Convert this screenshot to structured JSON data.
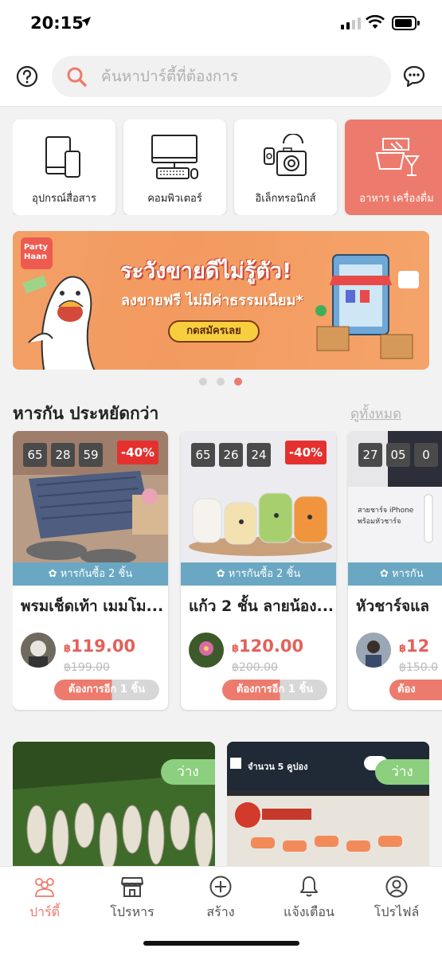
{
  "status": {
    "time": "20:15"
  },
  "search": {
    "placeholder": "ค้นหาปาร์ตี้ที่ต้องการ"
  },
  "categories": [
    {
      "label": "อุปกรณ์สื่อสาร",
      "icon": "phone-tablet-icon"
    },
    {
      "label": "คอมพิวเตอร์",
      "icon": "computer-icon"
    },
    {
      "label": "อิเล็กทรอนิกส์",
      "icon": "electronics-icon"
    },
    {
      "label": "อาหาร เครื่องดื่ม",
      "icon": "food-drink-icon",
      "active": true
    }
  ],
  "banner": {
    "logo": "Party Haan",
    "headline": "ระวังขายดีไม่รู้ตัว!",
    "subline": "ลงขายฟรี ไม่มีค่าธรรมเนียม*",
    "cta": "กดสมัครเลย"
  },
  "section": {
    "title": "หารกัน ประหยัดกว่า",
    "see_all": "ดูทั้งหมด"
  },
  "deals": [
    {
      "timer": [
        "65",
        "28",
        "59"
      ],
      "discount": "-40%",
      "group_tag": "หารกันซื้อ 2 ชิ้น",
      "name": "พรมเช็ดเท้า เมมโม...",
      "currency": "฿",
      "price": "119.00",
      "original_price": "฿199.00",
      "need": "ต้องการอีก 1 ชิ้น"
    },
    {
      "timer": [
        "65",
        "26",
        "24"
      ],
      "discount": "-40%",
      "group_tag": "หารกันซื้อ 2 ชิ้น",
      "name": "แก้ว 2 ชั้น ลายน้อง...",
      "currency": "฿",
      "price": "120.00",
      "original_price": "฿200.00",
      "need": "ต้องการอีก 1 ชิ้น"
    },
    {
      "timer": [
        "27",
        "05",
        "0"
      ],
      "discount": "",
      "group_tag": "หารกัน",
      "name": "หัวชาร์จแล",
      "currency": "฿",
      "price": "12",
      "original_price": "฿150.0",
      "need": "ต้อง"
    }
  ],
  "parties": [
    {
      "status": "ว่าง"
    },
    {
      "status": "ว่าง",
      "text": "จำนวน 5 คูปอง"
    }
  ],
  "tabs": [
    {
      "label": "ปาร์ตี้",
      "icon": "party-people-icon",
      "active": true
    },
    {
      "label": "โปรหาร",
      "icon": "store-icon"
    },
    {
      "label": "สร้าง",
      "icon": "plus-circle-icon"
    },
    {
      "label": "แจ้งเตือน",
      "icon": "bell-icon"
    },
    {
      "label": "โปรไฟล์",
      "icon": "user-icon"
    }
  ],
  "colors": {
    "accent": "#ed7b6d",
    "group_tag": "#6aa7c2",
    "available": "#8ccf7e",
    "discount": "#e4312f"
  }
}
